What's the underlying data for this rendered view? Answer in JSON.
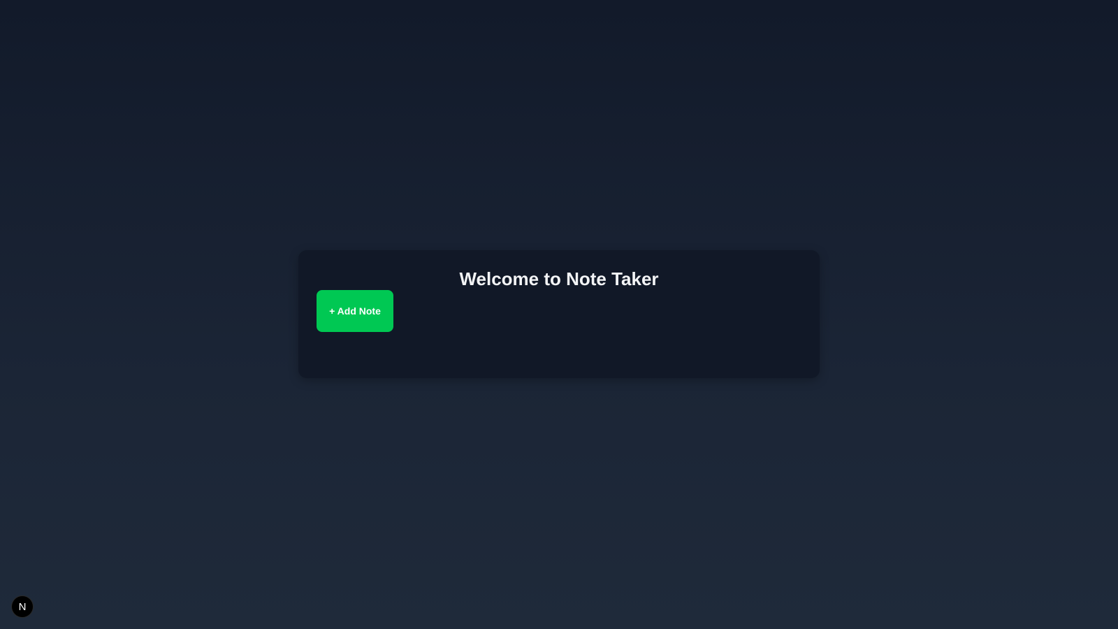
{
  "main": {
    "title": "Welcome to Note Taker",
    "add_note_label": "+ Add Note"
  },
  "dev_badge": {
    "letter": "N",
    "icon": "nextjs-logo-icon"
  },
  "colors": {
    "accent": "#00c853",
    "card": "#111827",
    "background": "#1b2536"
  }
}
